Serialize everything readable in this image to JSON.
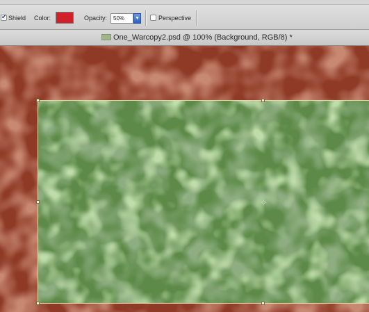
{
  "options_bar": {
    "shield": {
      "label": "Shield",
      "checked": true
    },
    "color": {
      "label": "Color:",
      "value": "#d0202a"
    },
    "opacity": {
      "label": "Opacity:",
      "value": "50%"
    },
    "perspective": {
      "label": "Perspective",
      "checked": false
    }
  },
  "document": {
    "title": "One_Warcopy2.psd @ 100% (Background, RGB/8) *"
  },
  "canvas": {
    "shield_color": "#8e3a26",
    "image_base_color": "#5d8a48"
  }
}
